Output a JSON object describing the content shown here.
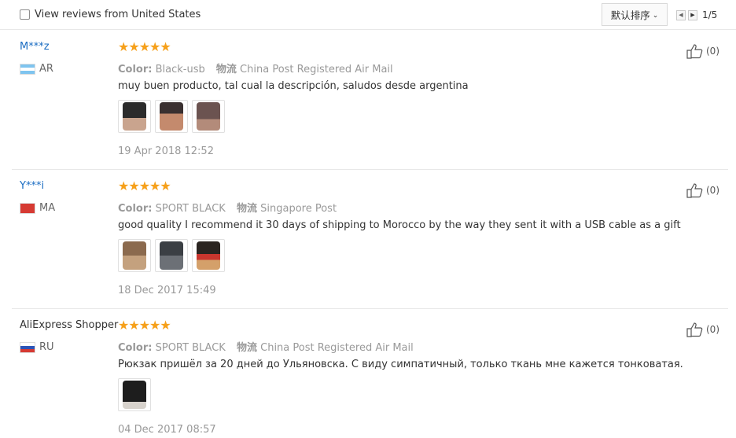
{
  "filter": {
    "label": "View reviews from United States",
    "checked": false
  },
  "sort": {
    "label": "默认排序"
  },
  "pagination": {
    "text": "1/5"
  },
  "reviews": [
    {
      "user": "M***z",
      "country": "AR",
      "stars": "★★★★★",
      "color_label": "Color:",
      "color": "Black-usb",
      "shipping_label": "物流",
      "shipping": "China Post Registered Air Mail",
      "text": "muy buen producto, tal cual la descripción, saludos desde argentina",
      "date": "19 Apr 2018 12:52",
      "likes": "(0)"
    },
    {
      "user": "Y***i",
      "country": "MA",
      "stars": "★★★★★",
      "color_label": "Color:",
      "color": "SPORT BLACK",
      "shipping_label": "物流",
      "shipping": "Singapore Post",
      "text": "good quality I recommend it 30 days of shipping to Morocco by the way they sent it with a USB cable as a gift",
      "date": "18 Dec 2017 15:49",
      "likes": "(0)"
    },
    {
      "user": "AliExpress Shopper",
      "country": "RU",
      "stars": "★★★★★",
      "color_label": "Color:",
      "color": "SPORT BLACK",
      "shipping_label": "物流",
      "shipping": "China Post Registered Air Mail",
      "text": "Рюкзак пришёл за 20 дней до Ульяновска. С виду симпатичный, только ткань мне кажется тонковатая.",
      "date": "04 Dec 2017 08:57",
      "likes": "(0)"
    }
  ],
  "colors": {
    "link": "#1a6cc2",
    "star": "#f6a01a",
    "muted": "#999999"
  }
}
